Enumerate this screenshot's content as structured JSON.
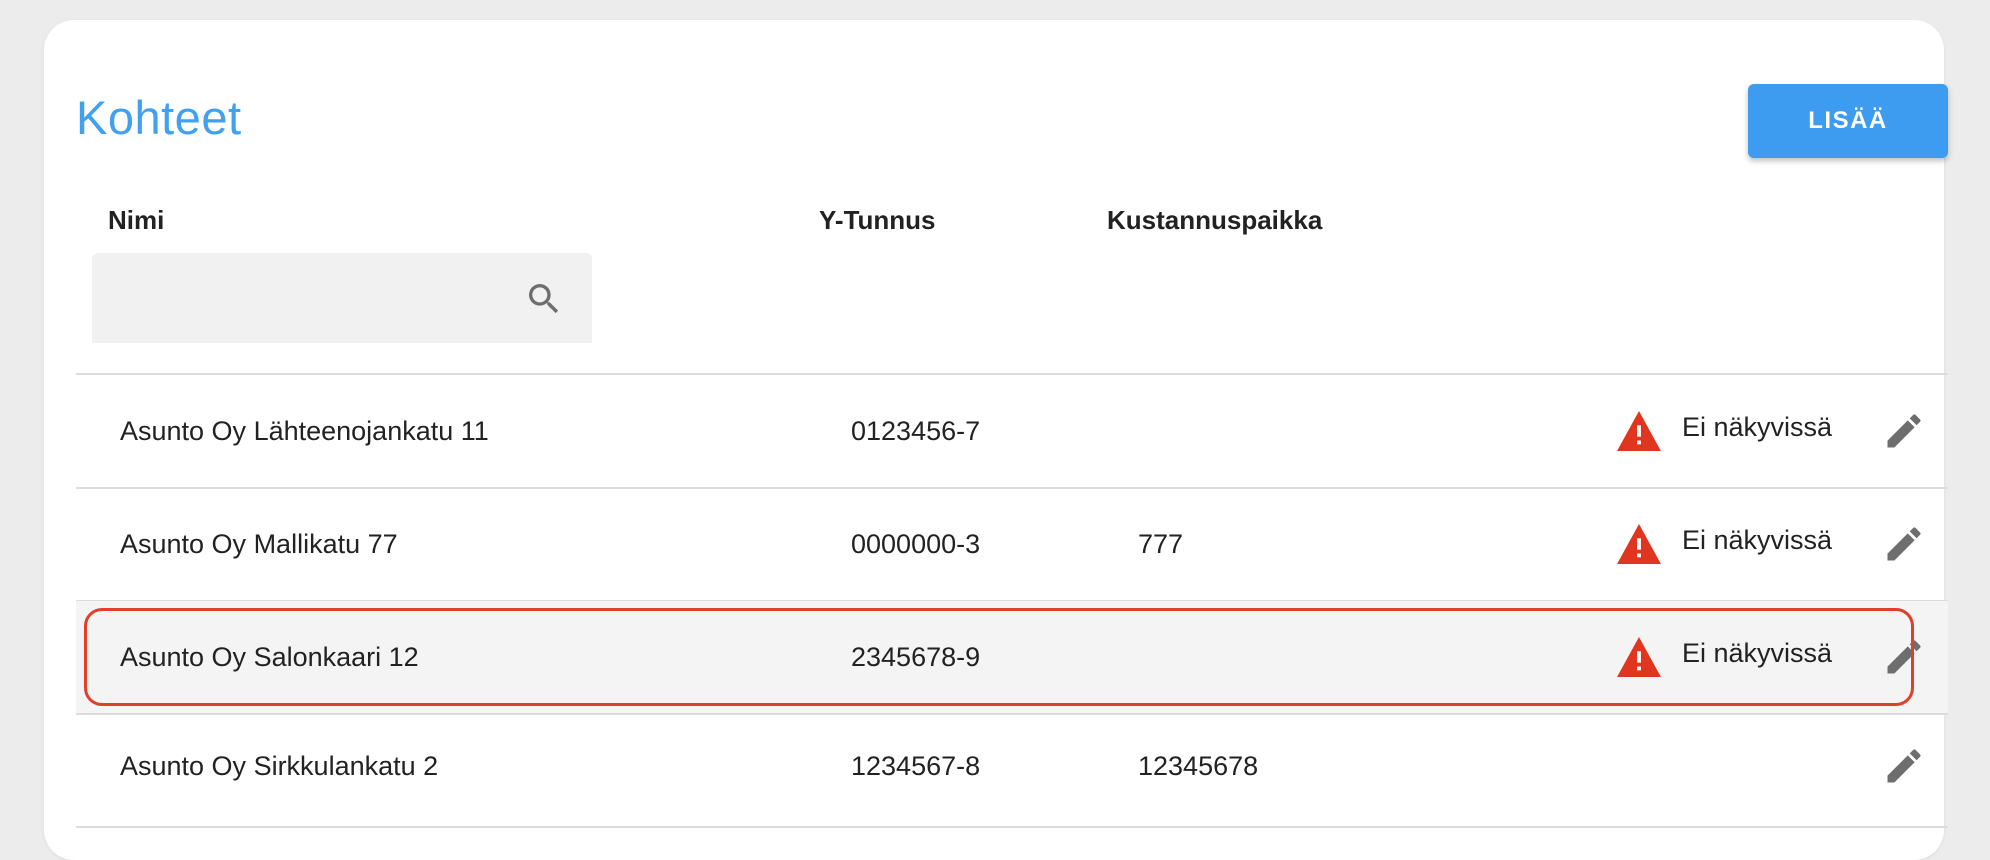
{
  "page": {
    "title": "Kohteet",
    "add_button_label": "LISÄÄ",
    "accent_color": "#42a0f0"
  },
  "columns": {
    "name": "Nimi",
    "ytunnus": "Y-Tunnus",
    "kustannuspaikka": "Kustannuspaikka"
  },
  "search": {
    "value": "",
    "icon": "search-icon"
  },
  "rows": [
    {
      "name": "Asunto Oy Lähteenojankatu 11",
      "ytunnus": "0123456-7",
      "kustannuspaikka": "",
      "status": "Ei näkyvissä",
      "warning": true,
      "selected": false
    },
    {
      "name": "Asunto Oy Mallikatu 77",
      "ytunnus": "0000000-3",
      "kustannuspaikka": "777",
      "status": "Ei näkyvissä",
      "warning": true,
      "selected": false
    },
    {
      "name": "Asunto Oy Salonkaari 12",
      "ytunnus": "2345678-9",
      "kustannuspaikka": "",
      "status": "Ei näkyvissä",
      "warning": true,
      "selected": true
    },
    {
      "name": "Asunto Oy Sirkkulankatu 2",
      "ytunnus": "1234567-8",
      "kustannuspaikka": "12345678",
      "status": "",
      "warning": false,
      "selected": false
    }
  ],
  "colors": {
    "warning": "#e0351f",
    "highlight_border": "#e0402a",
    "selected_row_bg": "#f4f4f4"
  }
}
